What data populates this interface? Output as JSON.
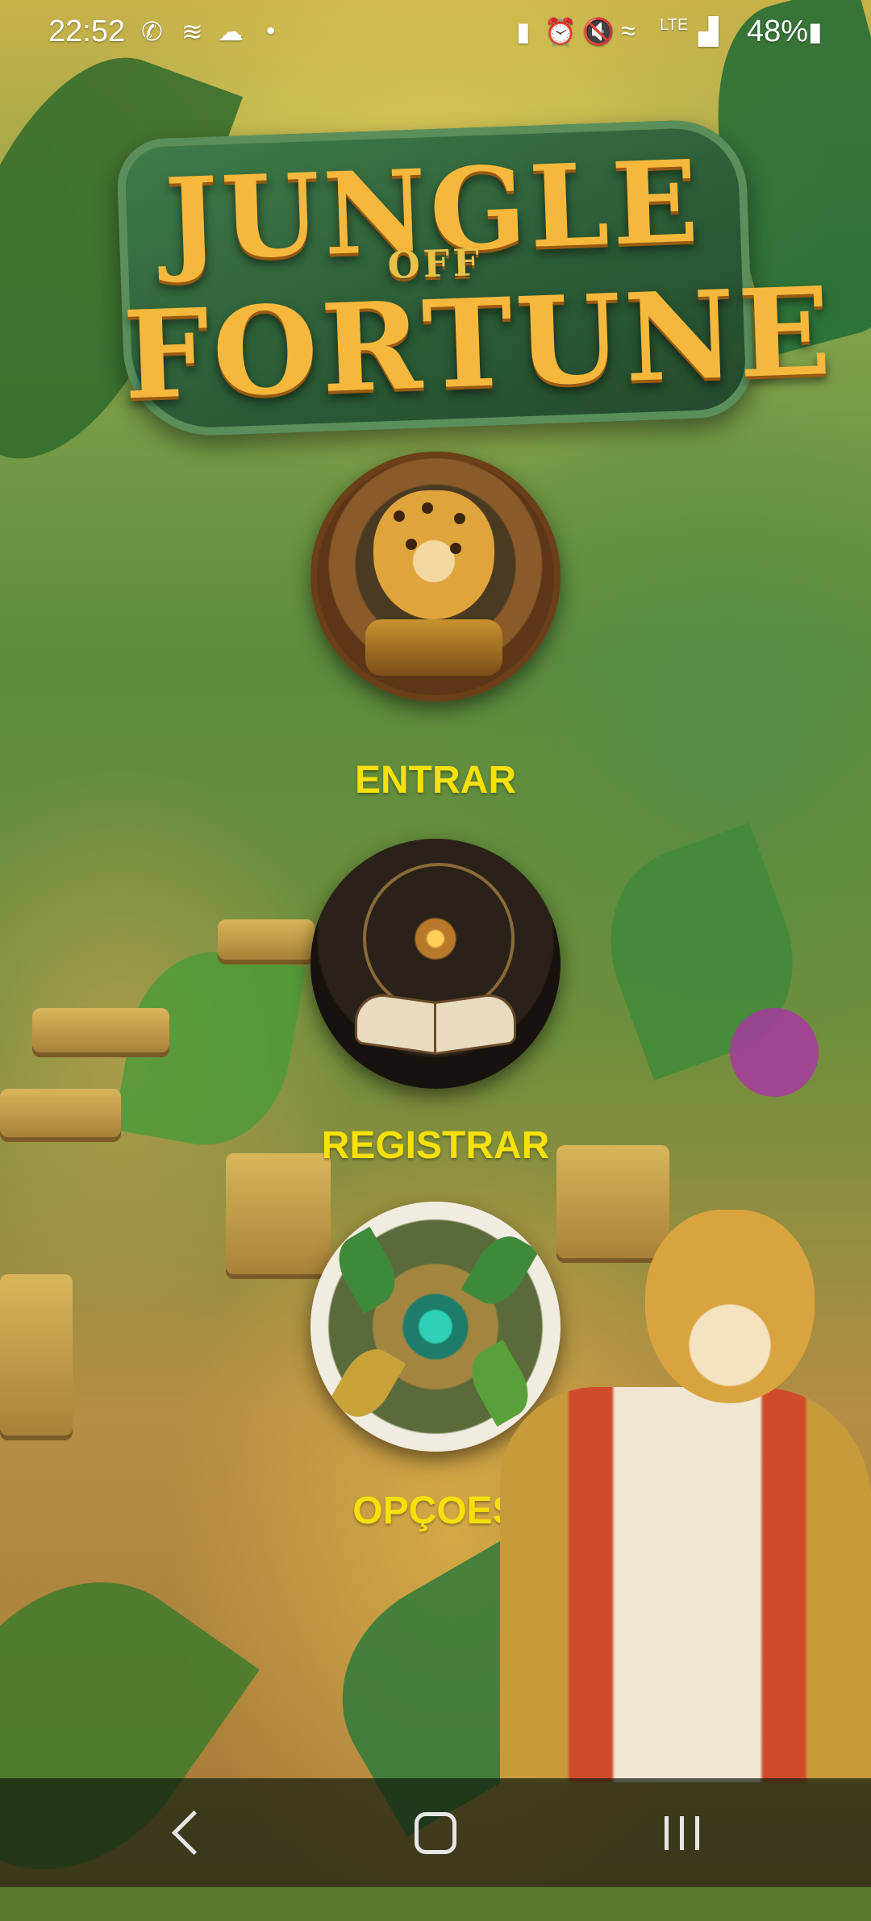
{
  "status_bar": {
    "time": "22:52",
    "battery_percent": "48%",
    "left_icons": [
      "whatsapp-icon",
      "signal-wave-icon",
      "cloud-icon",
      "dot-icon"
    ],
    "right_icons": [
      "battery-saver-icon",
      "alarm-icon",
      "mute-icon",
      "wifi-icon",
      "volte-icon",
      "cell-signal-icon",
      "battery-icon"
    ]
  },
  "logo": {
    "line1": "JUNGLE",
    "line2": "OFF",
    "line3": "FORTUNE"
  },
  "menu": {
    "enter_label": "ENTRAR",
    "register_label": "REGISTRAR",
    "options_label": "OPÇOES"
  },
  "colors": {
    "menu_text": "#f5e00a",
    "logo_text": "#f5b83c"
  },
  "nav_bar": {
    "buttons": [
      "back-icon",
      "home-icon",
      "recents-icon"
    ]
  }
}
